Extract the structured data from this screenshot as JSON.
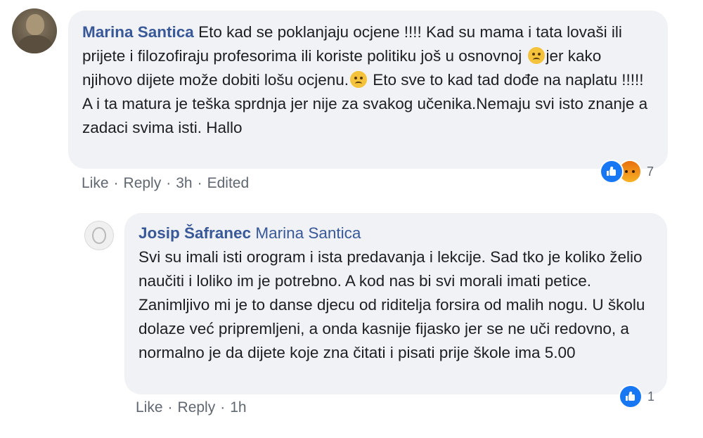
{
  "comment": {
    "author": "Marina Santica",
    "text_part1": "Eto kad se poklanjaju ocjene !!!! Kad su mama i tata lovaši ili prijete i filozofiraju profesorima ili koriste politiku još u osnovnoj ",
    "text_part2": "jer kako njihovo dijete može dobiti lošu ocjenu.",
    "text_part3": " Eto sve to kad tad dođe na naplatu !!!!! A i ta matura je teška sprdnja jer nije za svakog učenika.Nemaju svi isto znanje a zadaci svima isti. Hallo",
    "actions": {
      "like": "Like",
      "reply": "Reply",
      "time": "3h",
      "edited": "Edited",
      "dot": "·"
    },
    "reaction_count": "7",
    "reaction_icons": [
      "like-icon",
      "angry-icon"
    ],
    "emoji_icon": "confused-face-icon"
  },
  "reply": {
    "author": "Josip Šafranec",
    "mention": "Marina Santica",
    "text": "Svi su imali isti orogram i ista predavanja i lekcije. Sad tko je koliko želio naučiti i loliko im je potrebno. A kod nas bi svi morali imati petice. Zanimljivo mi je to danse djecu od riditelja forsira od malih nogu. U školu dolaze već pripremljeni, a onda kasnije fijasko jer se ne uči redovno, a normalno je da dijete koje zna čitati i pisati prije škole ima 5.00",
    "actions": {
      "like": "Like",
      "reply": "Reply",
      "time": "1h",
      "dot": "·"
    },
    "reaction_count": "1",
    "reaction_icons": [
      "like-icon"
    ]
  },
  "colors": {
    "bubble": "#f0f2f5",
    "author": "#385898",
    "meta": "#606770",
    "like": "#1877f2",
    "angry": "#e9710f"
  }
}
